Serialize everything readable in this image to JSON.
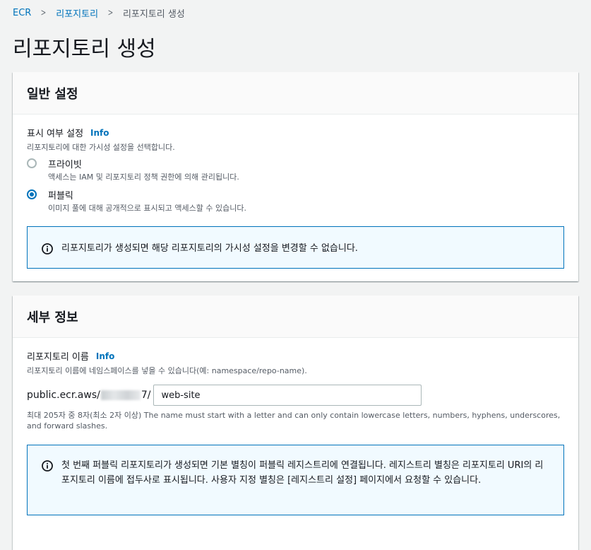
{
  "breadcrumb": {
    "items": [
      "ECR",
      "리포지토리",
      "리포지토리 생성"
    ]
  },
  "page_title": "리포지토리 생성",
  "general_settings": {
    "title": "일반 설정",
    "visibility_label": "표시 여부 설정",
    "info": "Info",
    "visibility_desc": "리포지토리에 대한 가시성 설정을 선택합니다.",
    "options": [
      {
        "label": "프라이빗",
        "desc": "액세스는 IAM 및 리포지토리 정책 권한에 의해 관리됩니다.",
        "selected": false
      },
      {
        "label": "퍼블릭",
        "desc": "이미지 풀에 대해 공개적으로 표시되고 액세스할 수 있습니다.",
        "selected": true
      }
    ],
    "alert": "리포지토리가 생성되면 해당 리포지토리의 가시성 설정을 변경할 수 없습니다."
  },
  "details": {
    "title": "세부 정보",
    "repo_name_label": "리포지토리 이름",
    "info": "Info",
    "repo_name_desc": "리포지토리 이름에 네임스페이스를 넣을 수 있습니다(예: namespace/repo-name).",
    "uri_prefix_start": "public.ecr.aws/",
    "uri_prefix_end": "7/",
    "repo_name_value": "web-site",
    "constraint": "최대 205자 중 8자(최소 2자 이상) The name must start with a letter and can only contain lowercase letters, numbers, hyphens, underscores, and forward slashes.",
    "alert": "첫 번째 퍼블릭 리포지토리가 생성되면 기본 별칭이 퍼블릭 레지스트리에 연결됩니다. 레지스트리 별칭은 리포지토리 URI의 리포지토리 이름에 접두사로 표시됩니다. 사용자 지정 별칭은 [레지스트리 설정] 페이지에서 요청할 수 있습니다."
  },
  "colors": {
    "link": "#0073bb",
    "alert_border": "#0073bb",
    "alert_bg": "#f1faff"
  }
}
